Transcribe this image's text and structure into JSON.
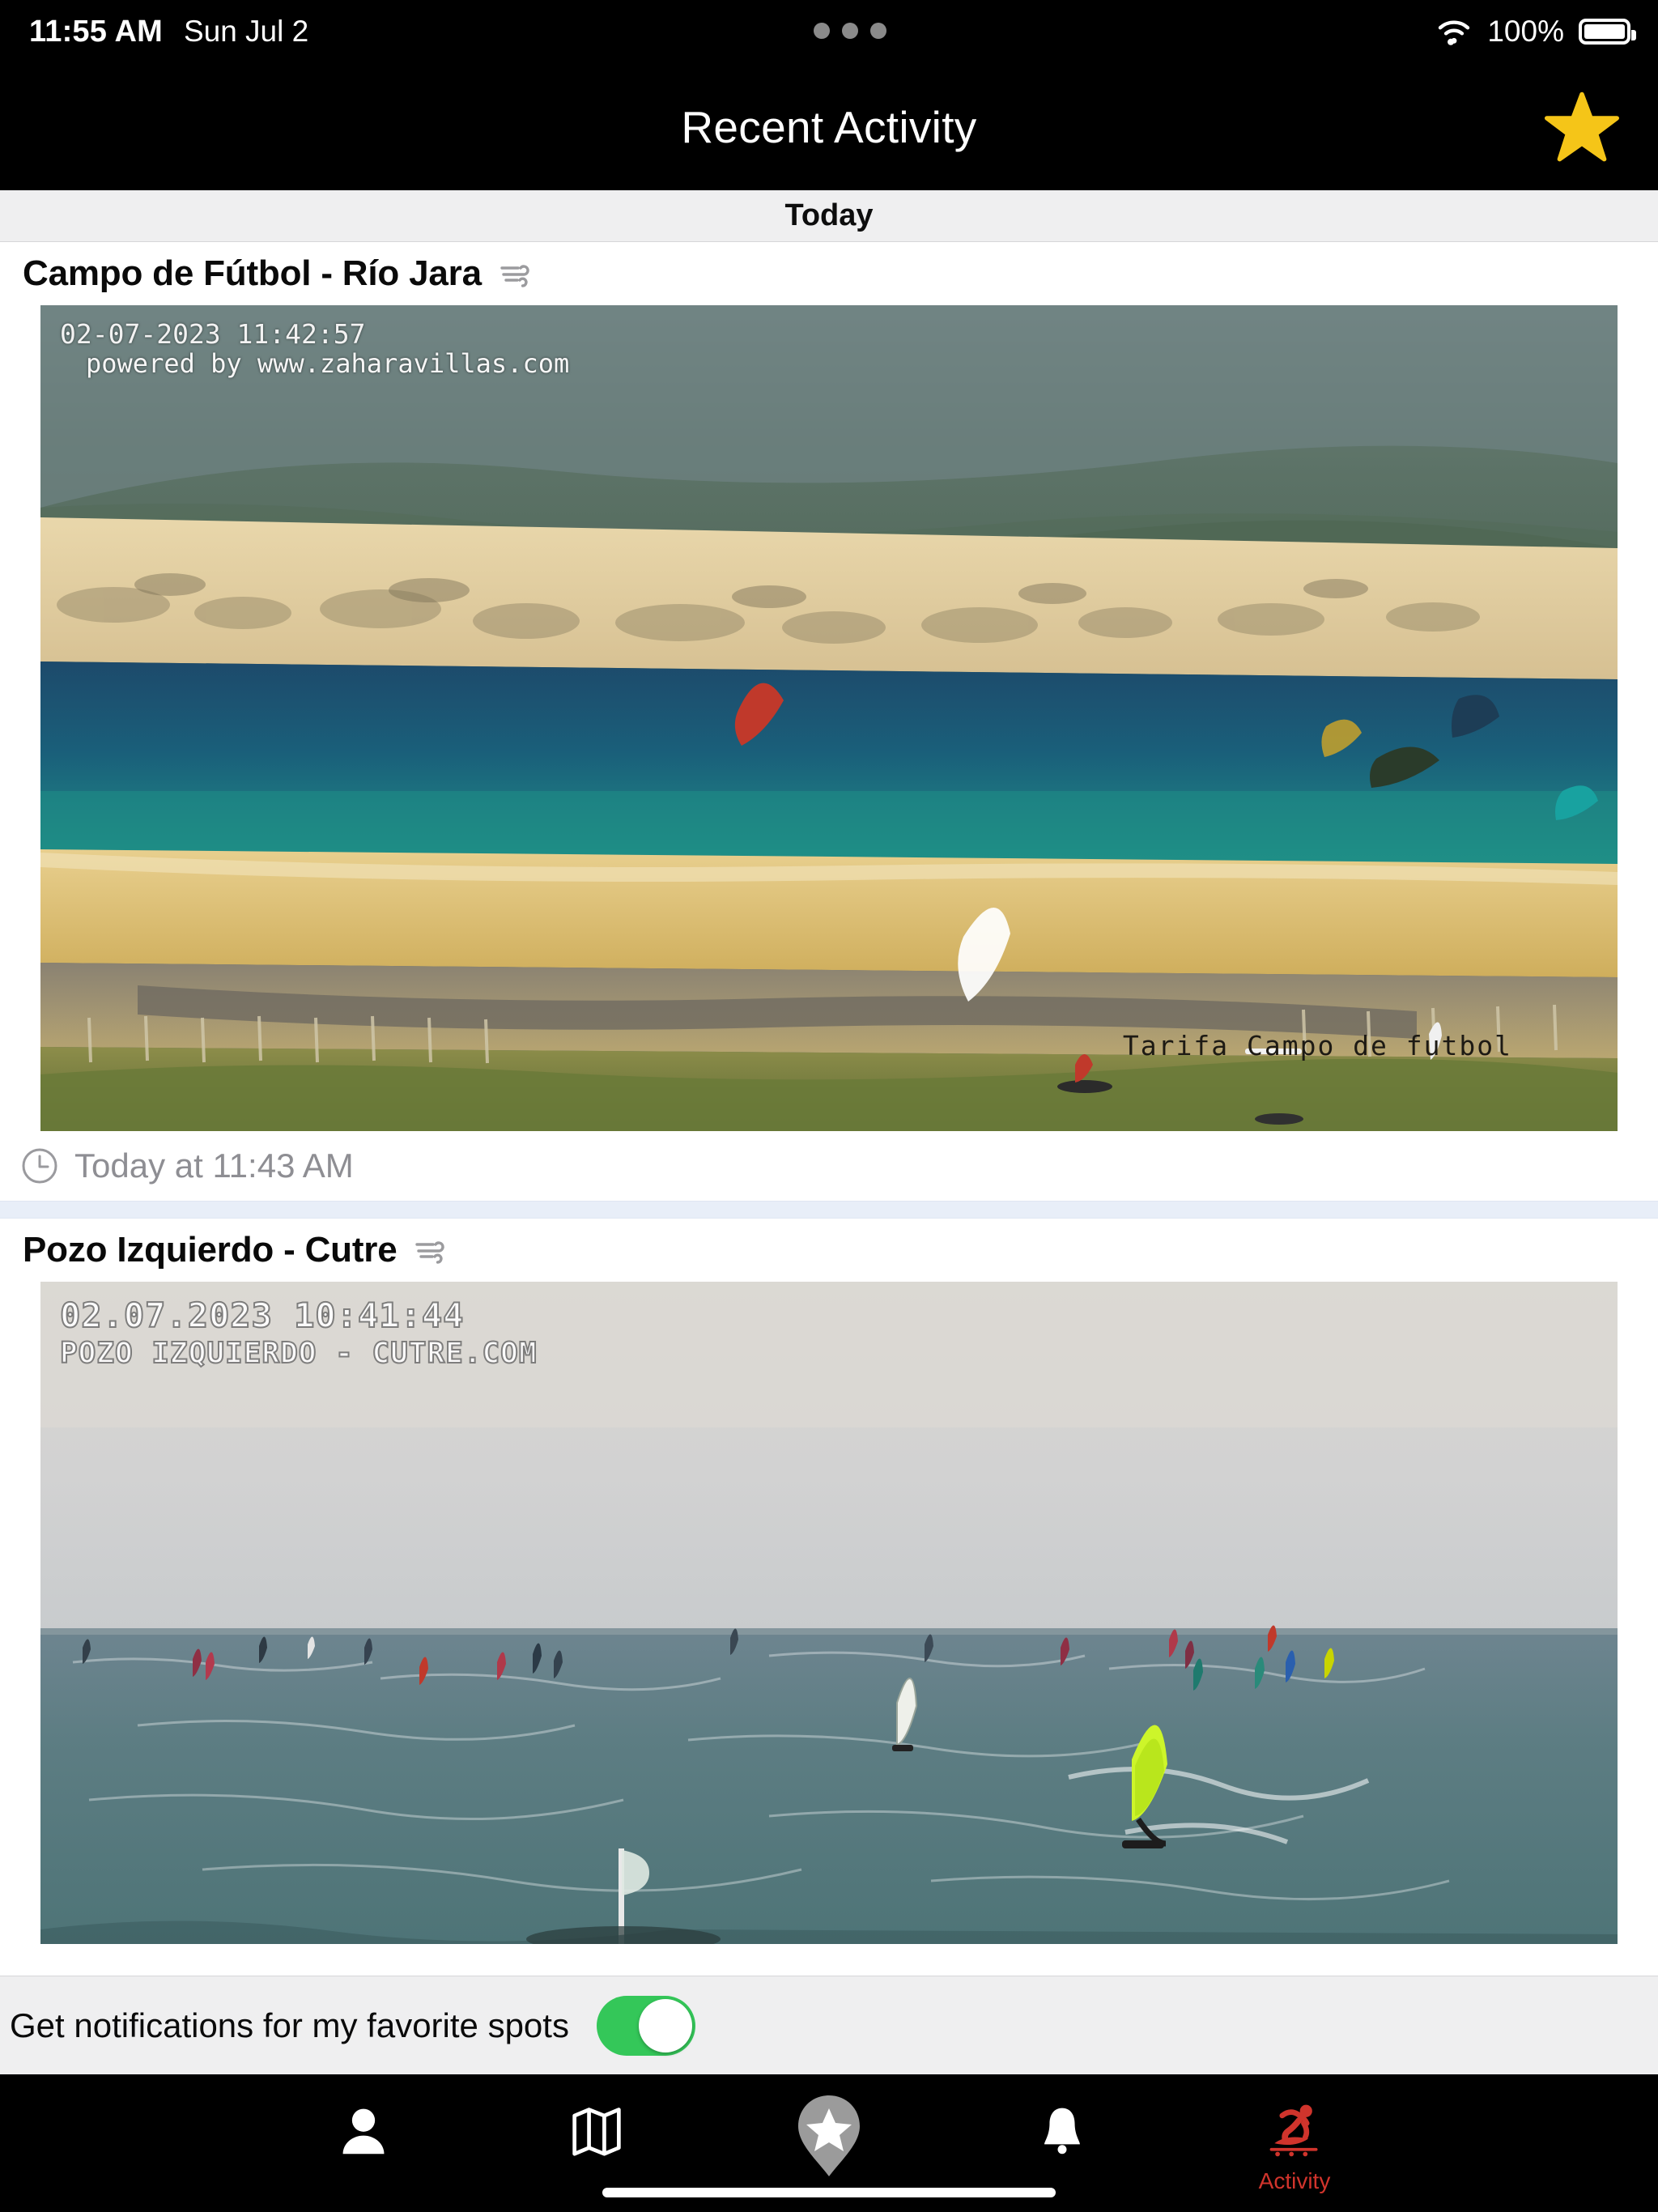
{
  "status_bar": {
    "time": "11:55 AM",
    "date": "Sun Jul 2",
    "battery_percent": "100%",
    "wifi_icon": "wifi-icon",
    "battery_icon": "battery-full-icon",
    "dots_icon": "three-dots-icon"
  },
  "nav_bar": {
    "title": "Recent Activity",
    "favorites_icon": "star-icon",
    "favorites_color": "#f5c518",
    "background": "#000000"
  },
  "section_header": {
    "label": "Today"
  },
  "activity": [
    {
      "title": "Campo de Fútbol - Río Jara",
      "wind_icon": "wind-icon",
      "webcam": {
        "stamp_date": "02-07-2023 11:42:57",
        "stamp_credit": "powered by www.zaharavillas.com",
        "watermark": "Tarifa Campo de futbol"
      },
      "timestamp": "Today at 11:43 AM",
      "clock_icon": "clock-icon"
    },
    {
      "title": "Pozo Izquierdo - Cutre",
      "wind_icon": "wind-icon",
      "webcam": {
        "stamp_date": "02.07.2023 10:41:44",
        "stamp_credit": "POZO IZQUIERDO - CUTRE.COM",
        "watermark": ""
      },
      "timestamp": "",
      "clock_icon": "clock-icon"
    }
  ],
  "notifications_row": {
    "label": "Get notifications for my favorite spots",
    "toggle_on": true,
    "toggle_color": "#34c759"
  },
  "tab_bar": {
    "items": [
      {
        "name": "profile",
        "label": "",
        "icon": "person-icon",
        "active": false
      },
      {
        "name": "map",
        "label": "",
        "icon": "map-icon",
        "active": false
      },
      {
        "name": "favorites",
        "label": "",
        "icon": "star-pin-icon",
        "active": false
      },
      {
        "name": "alerts",
        "label": "",
        "icon": "bell-icon",
        "active": false
      },
      {
        "name": "activity",
        "label": "Activity",
        "icon": "surfer-icon",
        "active": true
      }
    ],
    "active_color": "#d0342c",
    "inactive_color": "#ffffff"
  }
}
